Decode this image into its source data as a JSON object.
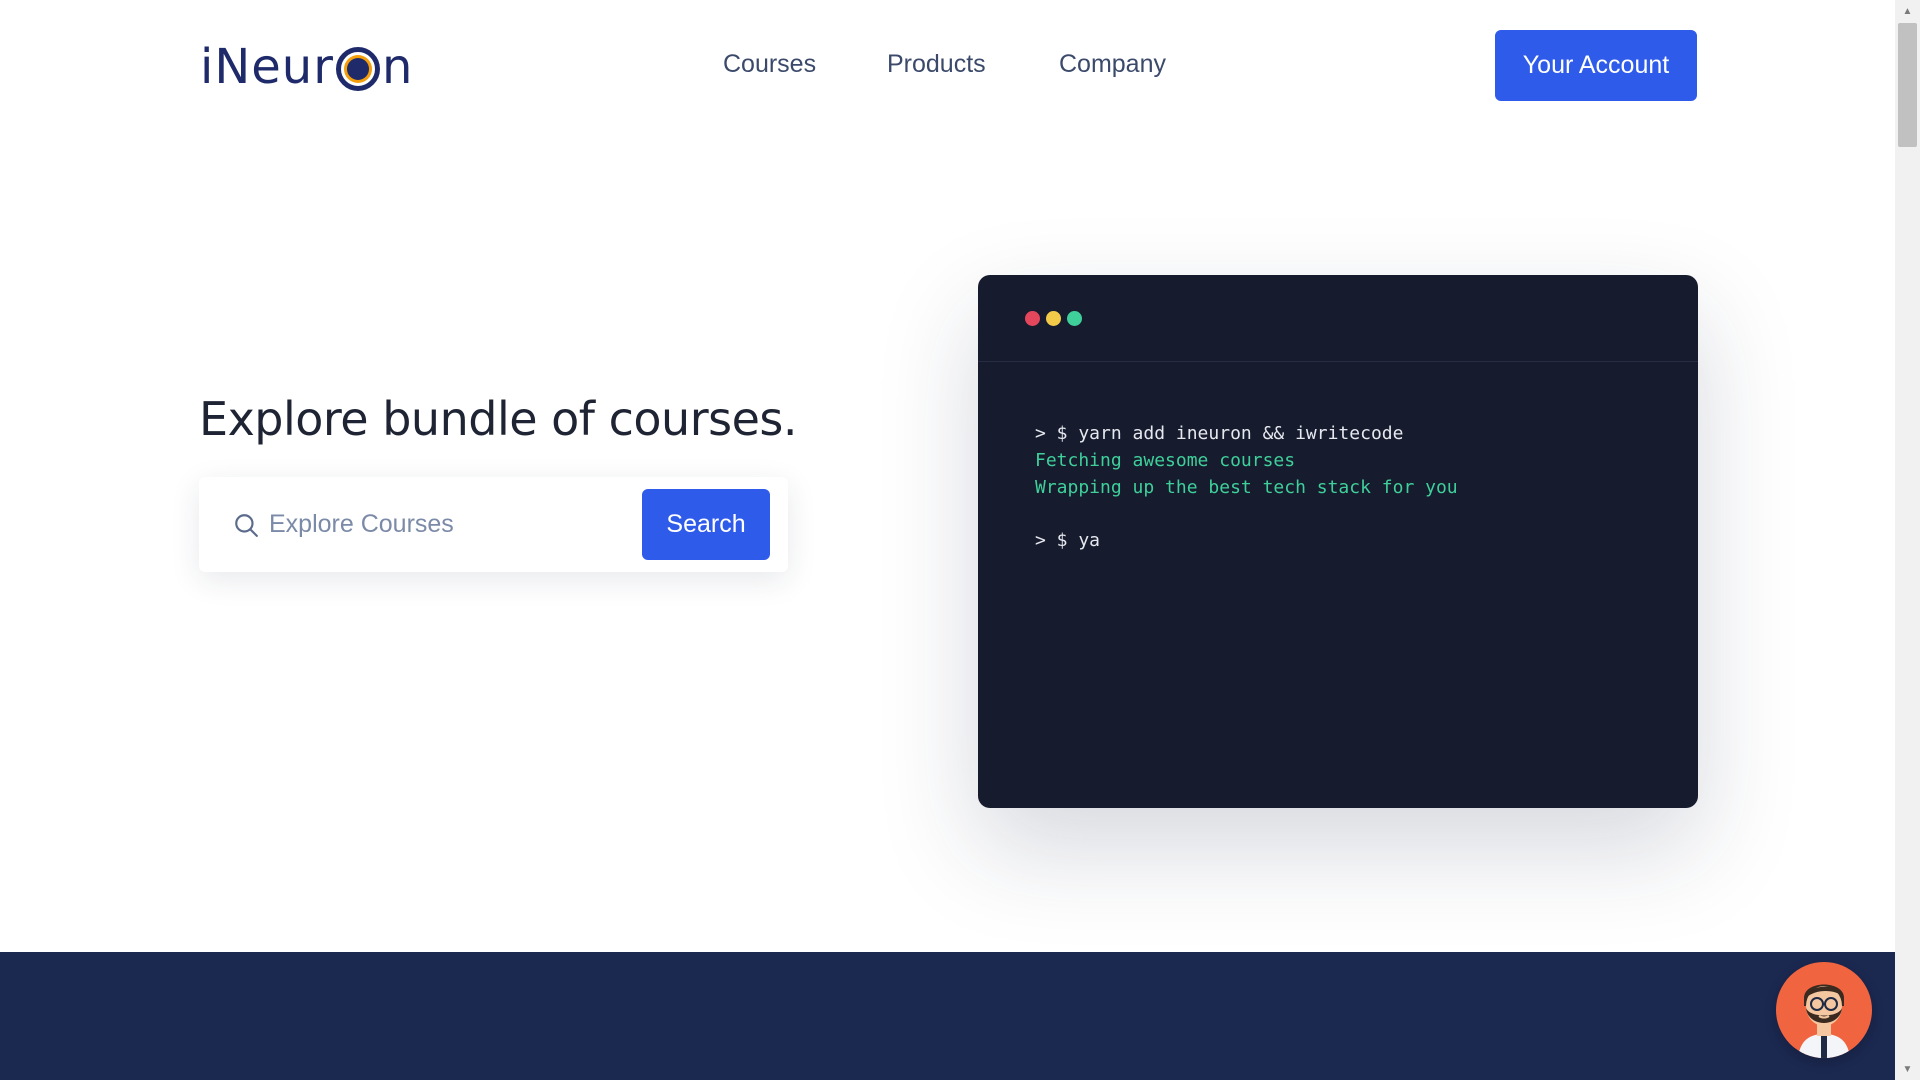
{
  "header": {
    "logo_text_start": "iNeur",
    "logo_text_end": "n",
    "nav": [
      {
        "label": "Courses"
      },
      {
        "label": "Products"
      },
      {
        "label": "Company"
      }
    ],
    "account_label": "Your Account"
  },
  "hero": {
    "title": "Explore bundle of courses.",
    "search": {
      "placeholder": "Explore Courses",
      "value": "",
      "button_label": "Search"
    }
  },
  "terminal": {
    "dot_colors": [
      "#e4475c",
      "#f3c94a",
      "#3fcf9a"
    ],
    "lines": [
      {
        "kind": "cmd",
        "text": "> $ yarn add ineuron && iwritecode"
      },
      {
        "kind": "out",
        "text": "Fetching awesome courses"
      },
      {
        "kind": "out",
        "text": "Wrapping up the best tech stack for you"
      },
      {
        "kind": "gap",
        "text": ""
      },
      {
        "kind": "cmd",
        "text": "> $ ya"
      }
    ]
  },
  "colors": {
    "primary": "#2f5bea",
    "brand_navy": "#1f2a6b",
    "logo_accent": "#f59e0b",
    "terminal_bg": "#161c2e",
    "footer_band": "#1b2850",
    "chat_avatar_bg": "#f0653f"
  },
  "icons": {
    "search": "search-icon",
    "chat": "chat-avatar-icon"
  }
}
